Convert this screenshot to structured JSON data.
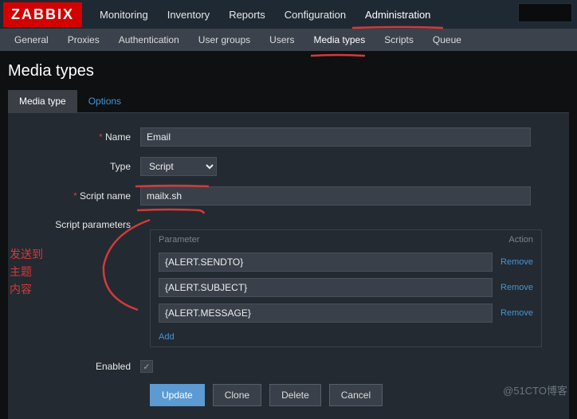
{
  "logo": "ZABBIX",
  "topnav": [
    "Monitoring",
    "Inventory",
    "Reports",
    "Configuration",
    "Administration"
  ],
  "subnav": [
    "General",
    "Proxies",
    "Authentication",
    "User groups",
    "Users",
    "Media types",
    "Scripts",
    "Queue"
  ],
  "page_title": "Media types",
  "tabs": {
    "media_type": "Media type",
    "options": "Options"
  },
  "form": {
    "name_label": "Name",
    "name_value": "Email",
    "type_label": "Type",
    "type_value": "Script",
    "script_name_label": "Script name",
    "script_name_value": "mailx.sh",
    "script_params_label": "Script parameters",
    "param_header": "Parameter",
    "action_header": "Action",
    "params": [
      {
        "value": "{ALERT.SENDTO}"
      },
      {
        "value": "{ALERT.SUBJECT}"
      },
      {
        "value": "{ALERT.MESSAGE}"
      }
    ],
    "remove": "Remove",
    "add": "Add",
    "enabled_label": "Enabled",
    "enabled": true
  },
  "buttons": {
    "update": "Update",
    "clone": "Clone",
    "delete": "Delete",
    "cancel": "Cancel"
  },
  "annotations": {
    "sendto": "发送到",
    "subject": "主题",
    "content": "内容"
  },
  "watermark": "@51CTO博客"
}
